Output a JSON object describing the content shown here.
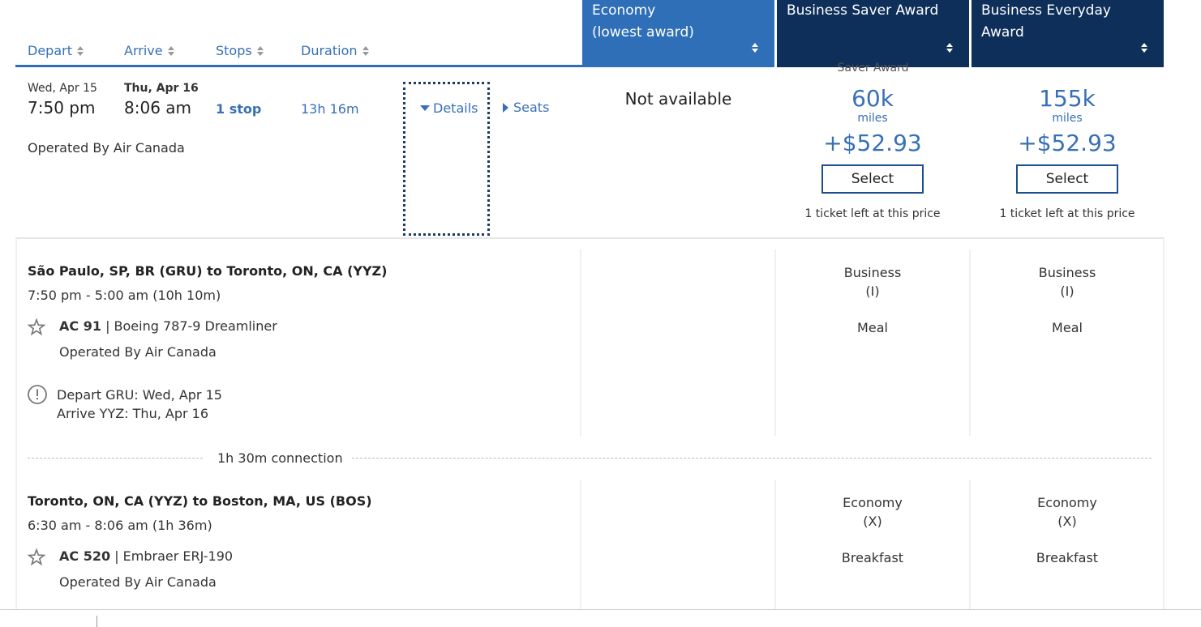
{
  "columns": {
    "depart": "Depart",
    "arrive": "Arrive",
    "stops": "Stops",
    "duration": "Duration"
  },
  "fare_headers": {
    "economy_line1": "Economy",
    "economy_line2": "(lowest award)",
    "business_saver": "Business Saver Award",
    "business_everyday": "Business Everyday Award",
    "colors": {
      "economy_bg": "#2f6fb8",
      "business_bg": "#0e2f5a"
    }
  },
  "flight": {
    "depart_date": "Wed, Apr 15",
    "depart_time": "7:50 pm",
    "arrive_date": "Thu, Apr 16",
    "arrive_time": "8:06 am",
    "stops": "1 stop",
    "duration": "13h 16m",
    "operated_by": "Operated By Air Canada",
    "details_label": "Details",
    "seats_label": "Seats"
  },
  "fares": {
    "economy": {
      "status": "Not available"
    },
    "saver": {
      "cut_label": "Saver Award",
      "miles": "60k",
      "miles_unit": "miles",
      "price": "+$52.93",
      "select_label": "Select",
      "tickets_left": "1 ticket left at this price"
    },
    "everyday": {
      "miles": "155k",
      "miles_unit": "miles",
      "price": "+$52.93",
      "select_label": "Select",
      "tickets_left": "1 ticket left at this price"
    }
  },
  "segments": [
    {
      "route": "São Paulo, SP, BR (GRU) to Toronto, ON, CA (YYZ)",
      "times": "7:50 pm - 5:00 am (10h 10m)",
      "flight_no": "AC 91",
      "aircraft": "| Boeing 787-9 Dreamliner",
      "operated_by": "Operated By Air Canada",
      "notice_line1": "Depart GRU: Wed, Apr 15",
      "notice_line2": "Arrive YYZ: Thu, Apr 16",
      "saver_cabin": "Business",
      "saver_class": "(I)",
      "saver_meal": "Meal",
      "everyday_cabin": "Business",
      "everyday_class": "(I)",
      "everyday_meal": "Meal"
    },
    {
      "route": "Toronto, ON, CA (YYZ) to Boston, MA, US (BOS)",
      "times": "6:30 am - 8:06 am (1h 36m)",
      "flight_no": "AC 520",
      "aircraft": "| Embraer ERJ-190",
      "operated_by": "Operated By Air Canada",
      "saver_cabin": "Economy",
      "saver_class": "(X)",
      "saver_meal": "Breakfast",
      "everyday_cabin": "Economy",
      "everyday_class": "(X)",
      "everyday_meal": "Breakfast"
    }
  ],
  "connection": "1h 30m connection"
}
